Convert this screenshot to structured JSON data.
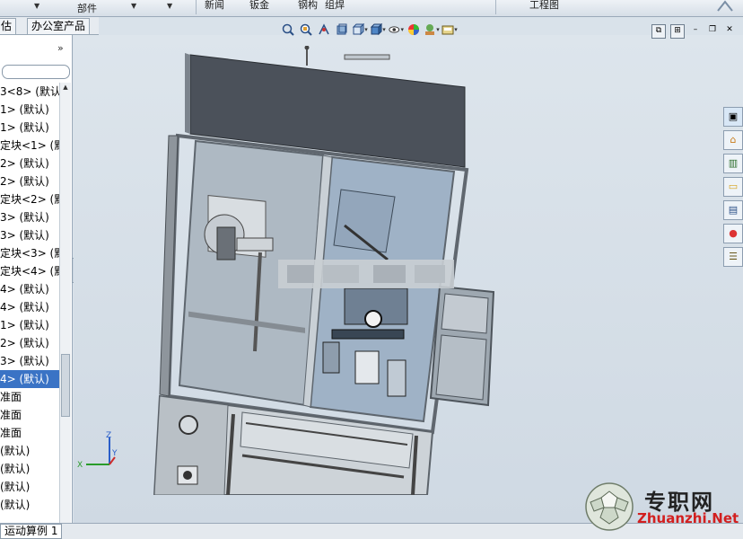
{
  "ribbon": {
    "item_parts": "部件",
    "item_a": "新闻",
    "item_b": "钣金",
    "item_c": "钢构",
    "item_d": "组焊",
    "item_e": "工程图"
  },
  "tabs": [
    {
      "label": "估"
    },
    {
      "label": "办公室产品"
    }
  ],
  "tree": {
    "items": [
      "3<8> (默认",
      "1> (默认)",
      "1> (默认)",
      "定块<1> (默",
      "2> (默认)",
      "2> (默认)",
      "定块<2> (默",
      "3> (默认)",
      "3> (默认)",
      "定块<3> (默",
      "定块<4> (默",
      "4> (默认)",
      "4> (默认)",
      "1> (默认)",
      "2> (默认)",
      "3> (默认)",
      "4> (默认)",
      "准面",
      "准面",
      "准面",
      "(默认)",
      "(默认)",
      "(默认)",
      "(默认)"
    ],
    "selected_index": 16
  },
  "status": {
    "tab_label": "运动算例 1"
  },
  "heads_up_toolbar": {
    "icons": [
      "zoom-to-fit-icon",
      "zoom-area-icon",
      "previous-view-icon",
      "section-view-icon",
      "view-orientation-icon",
      "display-style-icon",
      "hide-show-icon",
      "appearance-icon",
      "scene-icon",
      "view-settings-icon"
    ]
  },
  "window_buttons": [
    "restore-icon",
    "tile-icon",
    "minimize-icon",
    "maximize-icon",
    "close-icon"
  ],
  "taskpane": {
    "icons": [
      "solidworks-resources-icon",
      "home-icon",
      "design-library-icon",
      "file-explorer-icon",
      "view-palette-icon",
      "appearances-icon",
      "custom-properties-icon"
    ]
  },
  "triad": {
    "x": "X",
    "y": "Y",
    "z": "Z"
  },
  "watermark": {
    "title": "专职网",
    "url": "Zhuanzhi.Net"
  },
  "colors": {
    "viewport_top": "#dde5ec",
    "viewport_bottom": "#cfd9e3",
    "selection": "#3a73c5",
    "watermark_url": "#d21f1f",
    "glass": "#aabccc",
    "frame": "#6f7780"
  }
}
